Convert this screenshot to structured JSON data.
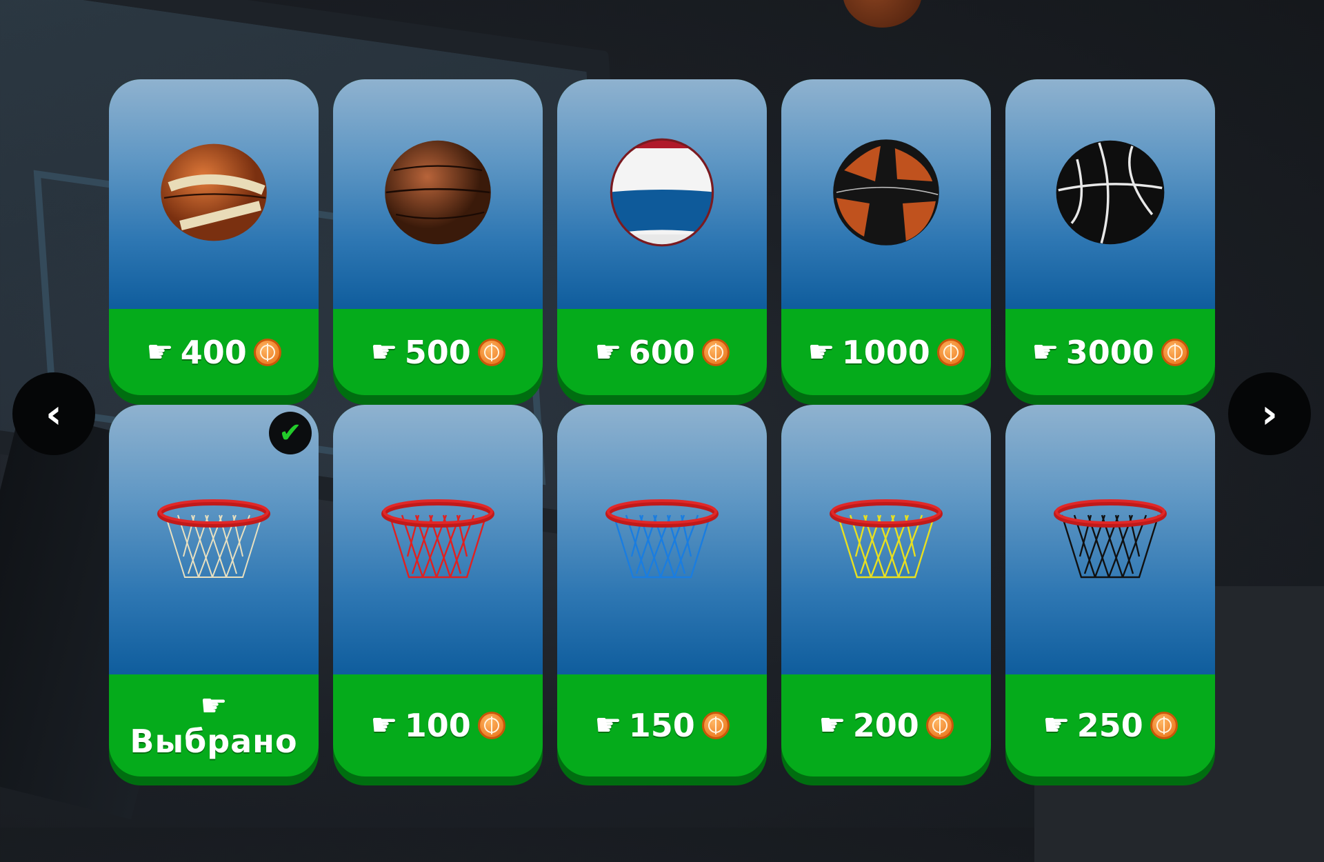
{
  "colors": {
    "card_price_bg": "#05ab1b",
    "card_price_edge": "#006e10",
    "card_gradient_top": "#8fb2cf",
    "card_gradient_bottom": "#0f5d9d",
    "coin": "#e66b10",
    "check": "#22cc2a"
  },
  "navigation": {
    "prev_icon": "chevron-left-icon",
    "next_icon": "chevron-right-icon",
    "prev_glyph": "‹",
    "next_glyph": "›"
  },
  "balls": [
    {
      "price": "400",
      "style": "orange-cream"
    },
    {
      "price": "500",
      "style": "brown-classic"
    },
    {
      "price": "600",
      "style": "red-white-blue"
    },
    {
      "price": "1000",
      "style": "black-orange"
    },
    {
      "price": "3000",
      "style": "black-white"
    }
  ],
  "hoops": [
    {
      "label": "Выбрано",
      "selected": true,
      "net_color": "#e8e0c0"
    },
    {
      "price": "100",
      "selected": false,
      "net_color": "#e02020"
    },
    {
      "price": "150",
      "selected": false,
      "net_color": "#1a7de0"
    },
    {
      "price": "200",
      "selected": false,
      "net_color": "#e8e020"
    },
    {
      "price": "250",
      "selected": false,
      "net_color": "#101010"
    }
  ],
  "icons": {
    "hand": "pointing-hand-icon",
    "coin": "basketball-coin-icon",
    "check": "checkmark-icon"
  }
}
